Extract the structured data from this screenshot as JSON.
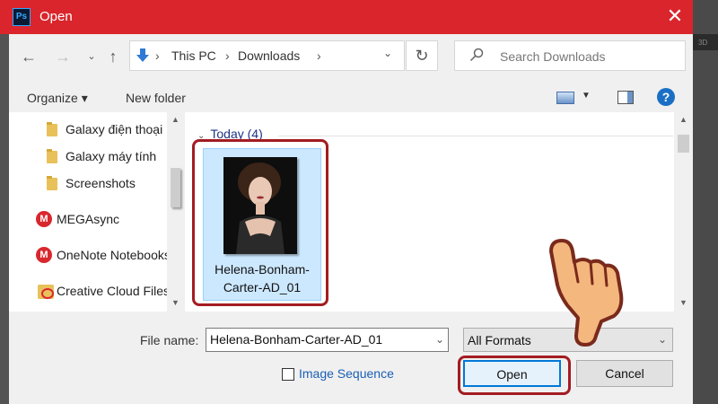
{
  "window": {
    "title": "Open",
    "app_logo": "Ps"
  },
  "nav": {
    "breadcrumb": [
      "This PC",
      "Downloads"
    ],
    "search_placeholder": "Search Downloads"
  },
  "toolbar": {
    "organize": "Organize ▾",
    "new_folder": "New folder"
  },
  "sidebar": {
    "items": [
      {
        "label": "Galaxy điện thoại",
        "icon": "folder-icon"
      },
      {
        "label": "Galaxy máy tính",
        "icon": "folder-icon"
      },
      {
        "label": "Screenshots",
        "icon": "folder-icon"
      },
      {
        "label": "MEGAsync",
        "icon": "mega-icon"
      },
      {
        "label": "OneNote Notebooks",
        "icon": "mega-icon"
      },
      {
        "label": "Creative Cloud Files",
        "icon": "creative-cloud-icon"
      }
    ]
  },
  "content": {
    "group_header": "Today (4)",
    "files": [
      {
        "name_line1": "Helena-Bonham-",
        "name_line2": "Carter-AD_01"
      }
    ]
  },
  "footer": {
    "file_name_label": "File name:",
    "file_name_value": "Helena-Bonham-Carter-AD_01",
    "format_value": "All Formats",
    "image_sequence_label": "Image Sequence",
    "open_label": "Open",
    "cancel_label": "Cancel"
  },
  "colors": {
    "titlebar": "#d9252b",
    "highlight": "#a31c22",
    "accent": "#0078d7"
  }
}
